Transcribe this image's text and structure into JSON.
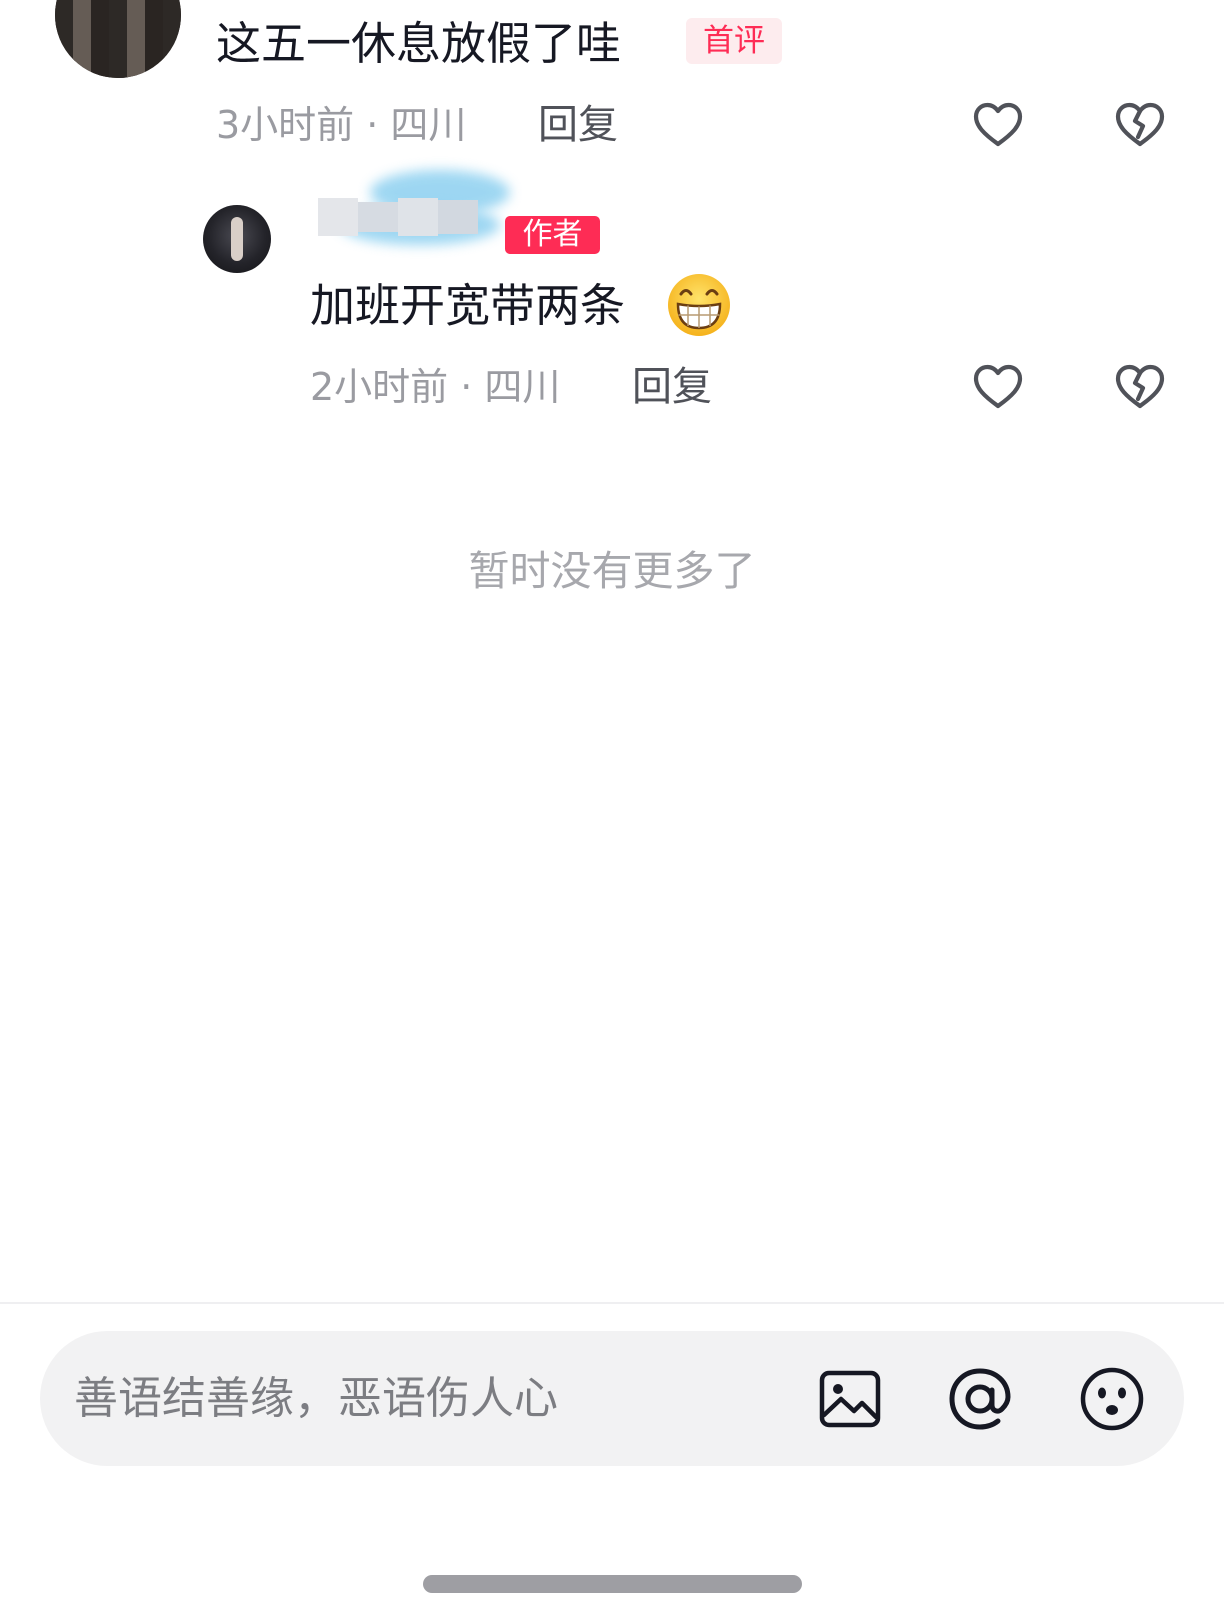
{
  "top_comment": {
    "text": "这五一休息放假了哇",
    "badge": "首评",
    "meta": "3小时前 · 四川",
    "reply_label": "回复",
    "like_icon": "heart-outline-icon",
    "dislike_icon": "broken-heart-icon"
  },
  "reply_comment": {
    "author_badge": "作者",
    "text": "加班开宽带两条",
    "emoji": "grinning-face-emoji",
    "meta": "2小时前 · 四川",
    "reply_label": "回复",
    "like_icon": "heart-outline-icon",
    "dislike_icon": "broken-heart-icon"
  },
  "end_of_list": "暂时没有更多了",
  "input": {
    "placeholder": "善语结善缘，恶语伤人心",
    "icons": [
      "image-icon",
      "at-mention-icon",
      "emoji-icon"
    ]
  },
  "colors": {
    "text_primary": "#161823",
    "text_secondary": "#9a9ba1",
    "accent": "#fe2c55",
    "input_bg": "#f2f2f3"
  }
}
